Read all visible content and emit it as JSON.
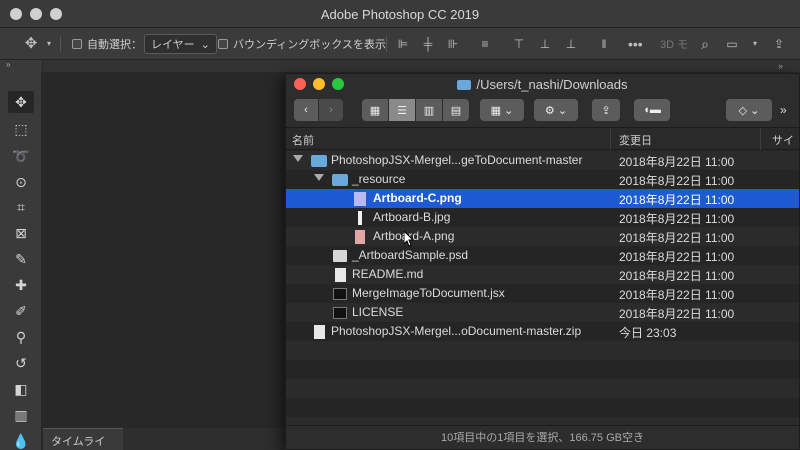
{
  "photoshop": {
    "title": "Adobe Photoshop CC 2019",
    "options": {
      "auto_select_label": "自動選択：",
      "layer_select_value": "レイヤー",
      "bbox_label": "バウンディングボックスを表示",
      "three_d": "3D モ"
    },
    "panel_collapse_left": "»",
    "panel_collapse_right": "»",
    "timeline_tab": "タイムライン"
  },
  "finder": {
    "title": "/Users/t_nashi/Downloads",
    "columns": {
      "name": "名前",
      "modified": "変更日",
      "size": "サイズ"
    },
    "rows": [
      {
        "name": "PhotoshopJSX-Mergel...geToDocument-master",
        "date": "2018年8月22日 11:00"
      },
      {
        "name": "_resource",
        "date": "2018年8月22日 11:00"
      },
      {
        "name": "Artboard-C.png",
        "date": "2018年8月22日 11:00"
      },
      {
        "name": "Artboard-B.jpg",
        "date": "2018年8月22日 11:00"
      },
      {
        "name": "Artboard-A.png",
        "date": "2018年8月22日 11:00"
      },
      {
        "name": "_ArtboardSample.psd",
        "date": "2018年8月22日 11:00"
      },
      {
        "name": "README.md",
        "date": "2018年8月22日 11:00"
      },
      {
        "name": "MergeImageToDocument.jsx",
        "date": "2018年8月22日 11:00"
      },
      {
        "name": "LICENSE",
        "date": "2018年8月22日 11:00"
      },
      {
        "name": "PhotoshopJSX-Mergel...oDocument-master.zip",
        "date": "今日 23:03"
      }
    ],
    "status": "10項目中の1項目を選択、166.75 GB空き"
  },
  "colors": {
    "selection": "#1d5ad4",
    "folder": "#6aa8dc",
    "close": "#fe5f57",
    "minimize": "#febc2e",
    "zoom": "#28c840"
  }
}
